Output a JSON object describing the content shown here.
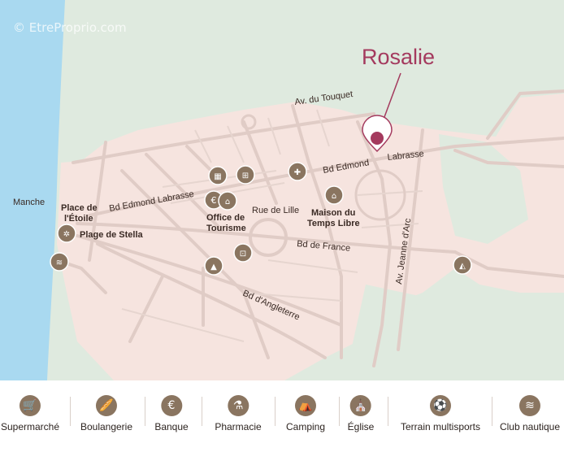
{
  "watermark": "© EtreProprio.com",
  "marker": {
    "label": "Rosalie",
    "color": "#a43a5e"
  },
  "colors": {
    "sea": "#a9d9f0",
    "land": "#dfeadf",
    "town": "#f6e4df",
    "road": "#e3d0ca",
    "poi": "#8a7560"
  },
  "labels": {
    "sea_name": "Manche",
    "av_touquet": "Av. du Touquet",
    "bd_edmond_west": "Bd Edmond Labrasse",
    "bd_edmond_east_1": "Bd Edmond",
    "bd_edmond_east_2": "Labrasse",
    "rue_lille": "Rue de Lille",
    "bd_france": "Bd de France",
    "bd_angleterre": "Bd d'Angleterre",
    "av_jeanne": "Av. Jeanne d'Arc",
    "place_etoile_1": "Place de",
    "place_etoile_2": "l'Étoile",
    "plage_stella": "Plage de Stella",
    "office_1": "Office de",
    "office_2": "Tourisme",
    "maison_1": "Maison du",
    "maison_2": "Temps Libre"
  },
  "legend": [
    {
      "icon": "cart-icon",
      "glyph": "🛒",
      "label": "Supermarché"
    },
    {
      "icon": "bread-icon",
      "glyph": "🥖",
      "label": "Boulangerie"
    },
    {
      "icon": "euro-icon",
      "glyph": "€",
      "label": "Banque"
    },
    {
      "icon": "mortar-icon",
      "glyph": "⚗",
      "label": "Pharmacie"
    },
    {
      "icon": "tent-icon",
      "glyph": "⛺",
      "label": "Camping"
    },
    {
      "icon": "church-icon",
      "glyph": "⛪",
      "label": "Église"
    },
    {
      "icon": "field-icon",
      "glyph": "⚽",
      "label": "Terrain multisports"
    },
    {
      "icon": "wave-icon",
      "glyph": "≋",
      "label": "Club nautique"
    }
  ]
}
